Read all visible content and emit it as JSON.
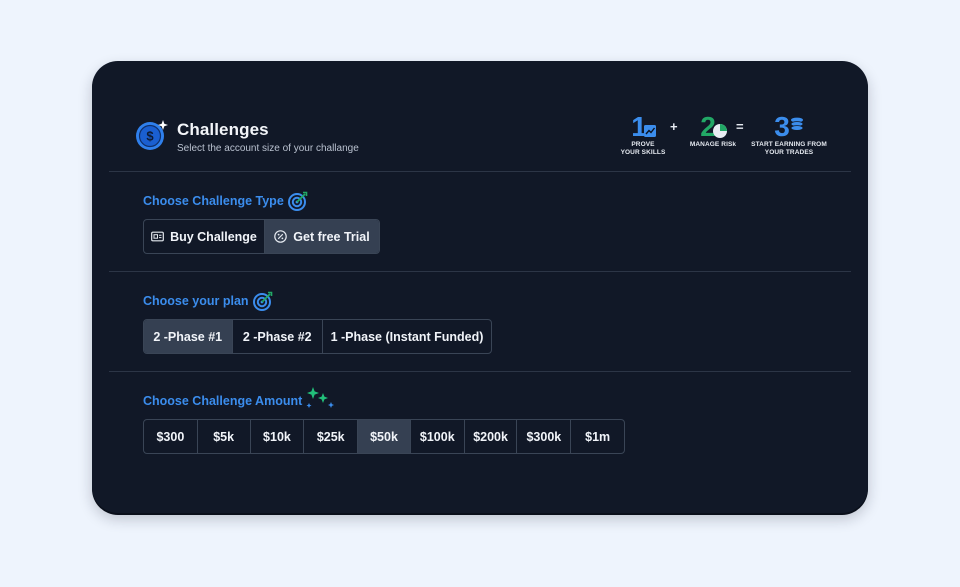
{
  "header": {
    "title": "Challenges",
    "subtitle": "Select the account size of your challange"
  },
  "steps": [
    {
      "number": "1",
      "caption_line1": "PROVE",
      "caption_line2": "YOUR SKILLS",
      "color": "#3b8ded"
    },
    {
      "number": "2",
      "caption_line1": "MANAGE RISk",
      "caption_line2": "",
      "color": "#22a866"
    },
    {
      "number": "3",
      "caption_line1": "START EARNING FROM",
      "caption_line2": "YOUR TRADES",
      "color": "#3b8ded"
    }
  ],
  "operators": {
    "plus": "+",
    "equals": "="
  },
  "type_section": {
    "label": "Choose Challenge Type",
    "options": [
      "Buy Challenge",
      "Get free Trial"
    ],
    "selected": "Get free Trial"
  },
  "plan_section": {
    "label": "Choose your plan",
    "options": [
      "2 -Phase #1",
      "2 -Phase #2",
      "1 -Phase (Instant Funded)"
    ],
    "selected": "2 -Phase #1"
  },
  "amount_section": {
    "label": "Choose Challenge Amount",
    "options": [
      "$300",
      "$5k",
      "$10k",
      "$25k",
      "$50k",
      "$100k",
      "$200k",
      "$300k",
      "$1m"
    ],
    "selected": "$50k"
  },
  "colors": {
    "accent_blue": "#3b8ded",
    "accent_green": "#22a866",
    "card_bg": "#111827",
    "page_bg": "#eef4fd"
  }
}
